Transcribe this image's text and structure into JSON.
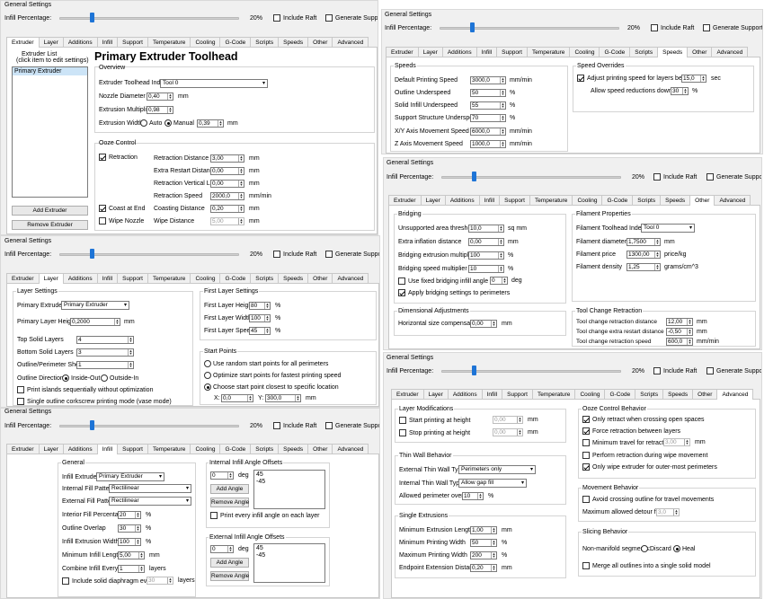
{
  "general": {
    "title": "General Settings",
    "infill_label": "Infill Percentage:",
    "infill_value": "20%",
    "infill_fraction": 0.2,
    "include_raft": "Include Raft",
    "generate_support": "Generate Support"
  },
  "tabs": [
    "Extruder",
    "Layer",
    "Additions",
    "Infill",
    "Support",
    "Temperature",
    "Cooling",
    "G-Code",
    "Scripts",
    "Speeds",
    "Other",
    "Advanced"
  ],
  "extruder": {
    "list_title_1": "Extruder List",
    "list_title_2": "(click item to edit settings)",
    "list_item": "Primary Extruder",
    "add_button": "Add Extruder",
    "remove_button": "Remove Extruder",
    "heading": "Primary Extruder Toolhead",
    "overview": "Overview",
    "toolhead_index_label": "Extruder Toolhead Index",
    "toolhead_index_value": "Tool 0",
    "nozzle_label": "Nozzle Diameter",
    "nozzle_value": "0,40",
    "mm": "mm",
    "multiplier_label": "Extrusion Multiplier",
    "multiplier_value": "0,98",
    "width_label": "Extrusion Width",
    "width_auto": "Auto",
    "width_manual": "Manual",
    "width_value": "0,39",
    "ooze": "Ooze Control",
    "retraction": "Retraction",
    "retraction_distance_label": "Retraction Distance",
    "retraction_distance_value": "3,00",
    "extra_restart_label": "Extra Restart Distance",
    "extra_restart_value": "0,00",
    "vertical_lift_label": "Retraction Vertical Lift",
    "vertical_lift_value": "0,00",
    "retraction_speed_label": "Retraction Speed",
    "retraction_speed_value": "2000,0",
    "mm_min": "mm/min",
    "coast_at_end": "Coast at End",
    "coasting_distance_label": "Coasting Distance",
    "coasting_distance_value": "0,20",
    "wipe_nozzle": "Wipe Nozzle",
    "wipe_distance_label": "Wipe Distance",
    "wipe_distance_value": "5,00"
  },
  "layer": {
    "group": "Layer Settings",
    "primary_extruder_label": "Primary Extruder",
    "primary_extruder_value": "Primary Extruder",
    "layer_height_label": "Primary Layer Height",
    "layer_height_value": "0,2000",
    "top_label": "Top Solid Layers",
    "top_value": "4",
    "bottom_label": "Bottom Solid Layers",
    "bottom_value": "3",
    "shells_label": "Outline/Perimeter Shells",
    "shells_value": "1",
    "direction_label": "Outline Direction:",
    "inside_out": "Inside-Out",
    "outside_in": "Outside-In",
    "print_islands": "Print islands sequentially without optimization",
    "vase_mode": "Single outline corkscrew printing mode (vase mode)",
    "first_group": "First Layer Settings",
    "first_height_label": "First Layer Height",
    "first_height_value": "80",
    "first_width_label": "First Layer Width",
    "first_width_value": "100",
    "first_speed_label": "First Layer Speed",
    "first_speed_value": "45",
    "pct": "%",
    "start_group": "Start Points",
    "random_start": "Use random start points for all perimeters",
    "optimize_start": "Optimize start points for fastest printing speed",
    "closest_start": "Choose start point closest to specific location",
    "x_label": "X:",
    "x_value": "0,0",
    "y_label": "Y:",
    "y_value": "300,0"
  },
  "infill": {
    "group": "General",
    "extruder_label": "Infill Extruder",
    "extruder_value": "Primary Extruder",
    "internal_label": "Internal Fill Pattern",
    "internal_value": "Rectilinear",
    "external_label": "External Fill Pattern",
    "external_value": "Rectilinear",
    "interior_label": "Interior Fill Percentage",
    "interior_value": "20",
    "overlap_label": "Outline Overlap",
    "overlap_value": "30",
    "extrusion_width_label": "Infill Extrusion Width",
    "extrusion_width_value": "100",
    "min_length_label": "Minimum Infill Length",
    "min_length_value": "5,00",
    "combine_label": "Combine Infill Every",
    "combine_value": "1",
    "layers": "layers",
    "diaphragm": "Include solid diaphragm every",
    "diaphragm_value": "30",
    "internal_angles": "Internal Infill Angle Offsets",
    "angle_value": "0",
    "deg": "deg",
    "add_angle": "Add Angle",
    "remove_angle": "Remove Angle",
    "angles": [
      "45",
      "-45"
    ],
    "print_every": "Print every infill angle on each layer",
    "external_angles": "External Infill Angle Offsets"
  },
  "speeds": {
    "group": "Speeds",
    "default_label": "Default Printing Speed",
    "default_value": "3000,0",
    "outline_label": "Outline Underspeed",
    "outline_value": "50",
    "solid_label": "Solid Infill Underspeed",
    "solid_value": "55",
    "support_label": "Support Structure Underspeed",
    "support_value": "70",
    "xy_label": "X/Y Axis Movement Speed",
    "xy_value": "6000,0",
    "z_label": "Z Axis Movement Speed",
    "z_value": "1000,0",
    "overrides": "Speed Overrides",
    "adjust": "Adjust printing speed for layers below",
    "adjust_value": "15,0",
    "sec": "sec",
    "allow": "Allow speed reductions down to",
    "allow_value": "30"
  },
  "other": {
    "bridging": "Bridging",
    "unsupported_label": "Unsupported area threshold",
    "unsupported_value": "10,0",
    "sq_mm": "sq mm",
    "inflation_label": "Extra inflation distance",
    "inflation_value": "0,00",
    "bridge_extrusion_label": "Bridging extrusion multiplier",
    "bridge_extrusion_value": "100",
    "bridge_speed_label": "Bridging speed multiplier",
    "bridge_speed_value": "10",
    "fixed_angle": "Use fixed bridging infill angle",
    "fixed_angle_value": "0",
    "apply_bridging": "Apply bridging settings to perimeters",
    "dimensional": "Dimensional Adjustments",
    "horizontal_label": "Horizontal size compensation",
    "horizontal_value": "0,00",
    "filament": "Filament Properties",
    "fil_index_label": "Filament Toolhead Index",
    "fil_index_value": "Tool 0",
    "fil_diameter_label": "Filament diameter",
    "fil_diameter_value": "1,7500",
    "fil_price_label": "Filament price",
    "fil_price_value": "1300,00",
    "price_kg": "price/kg",
    "fil_density_label": "Filament density",
    "fil_density_value": "1,25",
    "grams": "grams/cm^3",
    "tool_change": "Tool Change Retraction",
    "tc_distance_label": "Tool change retraction distance",
    "tc_distance_value": "12,00",
    "tc_extra_label": "Tool change extra restart distance",
    "tc_extra_value": "-0,50",
    "tc_speed_label": "Tool change retraction speed",
    "tc_speed_value": "600,0"
  },
  "advanced": {
    "layer_mods": "Layer Modifications",
    "start_height": "Start printing at height",
    "start_height_value": "0,00",
    "stop_height": "Stop printing at height",
    "stop_height_value": "0,00",
    "thin_wall": "Thin Wall Behavior",
    "external_thin_label": "External Thin Wall Type",
    "external_thin_value": "Perimeters only",
    "internal_thin_label": "Internal Thin Wall Type",
    "internal_thin_value": "Allow gap fill",
    "allowed_overlap_label": "Allowed perimeter overlap",
    "allowed_overlap_value": "10",
    "single_ext": "Single Extrusions",
    "min_ext_label": "Minimum Extrusion Length",
    "min_ext_value": "1,00",
    "min_width_label": "Minimum Printing Width",
    "min_width_value": "50",
    "max_width_label": "Maximum Printing Width",
    "max_width_value": "200",
    "endpoint_label": "Endpoint Extension Distance",
    "endpoint_value": "0,20",
    "ooze": "Ooze Control Behavior",
    "only_retract": "Only retract when crossing open spaces",
    "force_retract": "Force retraction between layers",
    "min_travel": "Minimum travel for retraction",
    "min_travel_value": "3,00",
    "perform_retract": "Perform retraction during wipe movement",
    "only_wipe": "Only wipe extruder for outer-most perimeters",
    "movement": "Movement Behavior",
    "avoid_crossing": "Avoid crossing outline for travel movements",
    "max_detour_label": "Maximum allowed detour factor",
    "max_detour_value": "3,0",
    "slicing": "Slicing Behavior",
    "non_manifold": "Non-manifold segments:",
    "discard": "Discard",
    "heal": "Heal",
    "merge": "Merge all outlines into a single solid model"
  }
}
